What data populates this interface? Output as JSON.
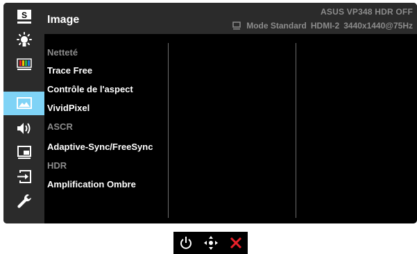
{
  "sidebar": {
    "items": [
      {
        "icon": "splendid-icon",
        "letter": "S"
      },
      {
        "icon": "blue-light-filter-icon"
      },
      {
        "icon": "color-icon"
      },
      {
        "icon": "image-icon",
        "active": true
      },
      {
        "icon": "sound-icon"
      },
      {
        "icon": "pip-pbp-icon"
      },
      {
        "icon": "input-select-icon"
      },
      {
        "icon": "system-setup-icon"
      }
    ],
    "accent_color": "#7fd3f6"
  },
  "header": {
    "title": "Image",
    "model": "ASUS  VP348 HDR OFF",
    "mode": "Mode Standard",
    "input": "HDMI-2",
    "resolution": "3440x1440@75Hz"
  },
  "menu": {
    "items": [
      {
        "label": "Netteté",
        "enabled": false
      },
      {
        "label": "Trace Free",
        "enabled": true
      },
      {
        "label": "Contrôle de l'aspect",
        "enabled": true
      },
      {
        "label": "VividPixel",
        "enabled": true
      },
      {
        "label": "ASCR",
        "enabled": false
      },
      {
        "label": "Adaptive-Sync/FreeSync",
        "enabled": true
      },
      {
        "label": "HDR",
        "enabled": false
      },
      {
        "label": "Amplification Ombre",
        "enabled": true
      }
    ]
  },
  "keys": [
    {
      "icon": "power-icon"
    },
    {
      "icon": "five-way-navigation-icon"
    },
    {
      "icon": "close-icon",
      "color": "#e8212a"
    }
  ]
}
